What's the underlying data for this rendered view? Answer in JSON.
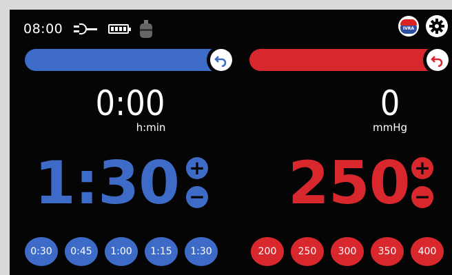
{
  "status": {
    "time": "08:00",
    "icons": [
      "plug-icon",
      "battery-icon",
      "bladder-icon"
    ]
  },
  "header_icons": [
    "logo-icon",
    "gear-icon"
  ],
  "colors": {
    "blue": "#3d6bc7",
    "red": "#d9272e",
    "background": "#050505"
  },
  "timer": {
    "progress": 1.0,
    "current": "0:00",
    "unit": "h:min",
    "setpoint": "1:30",
    "presets": [
      "0:30",
      "0:45",
      "1:00",
      "1:15",
      "1:30"
    ]
  },
  "pressure": {
    "progress": 1.0,
    "current": "0",
    "unit": "mmHg",
    "setpoint": "250",
    "presets": [
      "200",
      "250",
      "300",
      "350",
      "400"
    ]
  },
  "increment_label": "+",
  "decrement_label": "−"
}
